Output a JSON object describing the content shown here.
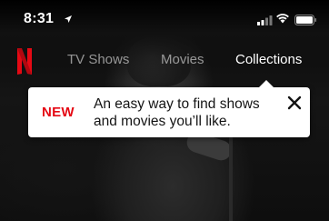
{
  "status_bar": {
    "time": "8:31",
    "icons": [
      "location-arrow-icon",
      "cellular-signal-icon",
      "wifi-icon",
      "battery-icon"
    ]
  },
  "app": {
    "logo": "N",
    "brand_color": "#e50914"
  },
  "nav": {
    "items": [
      {
        "label": "TV Shows",
        "active": false
      },
      {
        "label": "Movies",
        "active": false
      },
      {
        "label": "Collections",
        "active": true
      }
    ]
  },
  "tooltip": {
    "badge": "NEW",
    "message_line1": "An easy way to find shows",
    "message_line2": "and movies you’ll like.",
    "close_icon": "close-icon"
  }
}
